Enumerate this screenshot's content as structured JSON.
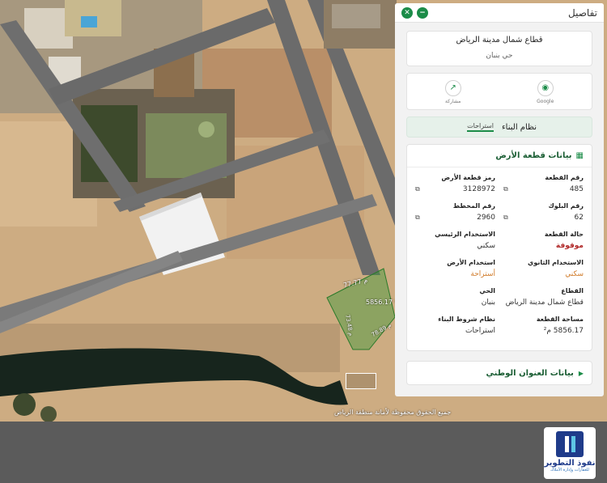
{
  "panel": {
    "title": "تفاصيل",
    "close_icon": "close-icon",
    "minimize_icon": "minimize-icon",
    "sector_name": "قطاع شمال مدينة الرياض",
    "district_name": "حي بنبان",
    "actions": [
      {
        "label": "Google",
        "icon": "google-maps-icon"
      },
      {
        "label": "مشاركة",
        "icon": "share-icon"
      }
    ],
    "tab_main": "نظام البناء",
    "tab_sub": "استراحات",
    "land_section_title": "بيانات قطعة الأرض",
    "land_fields": [
      {
        "label": "رقم القطعة",
        "value": "485",
        "copyable": true
      },
      {
        "label": "رمز قطعة الأرض",
        "value": "3128972",
        "copyable": true
      },
      {
        "label": "رقم البلوك",
        "value": "62",
        "copyable": true
      },
      {
        "label": "رقم المخطط",
        "value": "2960",
        "copyable": true
      },
      {
        "label": "حالة القطعة",
        "value": "موقوفة",
        "style": "red"
      },
      {
        "label": "الاستخدام الرئيسي",
        "value": "سكني"
      },
      {
        "label": "الاستخدام الثانوي",
        "value": "سكني",
        "style": "orange"
      },
      {
        "label": "استخدام الأرض",
        "value": "أستراحة",
        "style": "orange"
      },
      {
        "label": "القطاع",
        "value": "قطاع شمال مدينة الرياض"
      },
      {
        "label": "الحي",
        "value": "بنبان"
      },
      {
        "label": "مساحة القطعة",
        "value": "5856.17 م²"
      },
      {
        "label": "نظام شروط البناء",
        "value": "استراحات"
      }
    ],
    "address_section_title": "بيانات العنوان الوطني"
  },
  "map": {
    "parcel_area_label": "5856.17 م²",
    "edge_label_top": "77.77 م",
    "edge_label_left": "73.48 م",
    "edge_label_right": "78.89 م",
    "copyright": "جميع الحقوق محفوظة لأمانة منطقة الرياض",
    "parcel_color": "#3f9a3a"
  },
  "logo": {
    "name": "نفوذ التطوير",
    "tagline": "للعقارات وإدارة الأملاك"
  }
}
